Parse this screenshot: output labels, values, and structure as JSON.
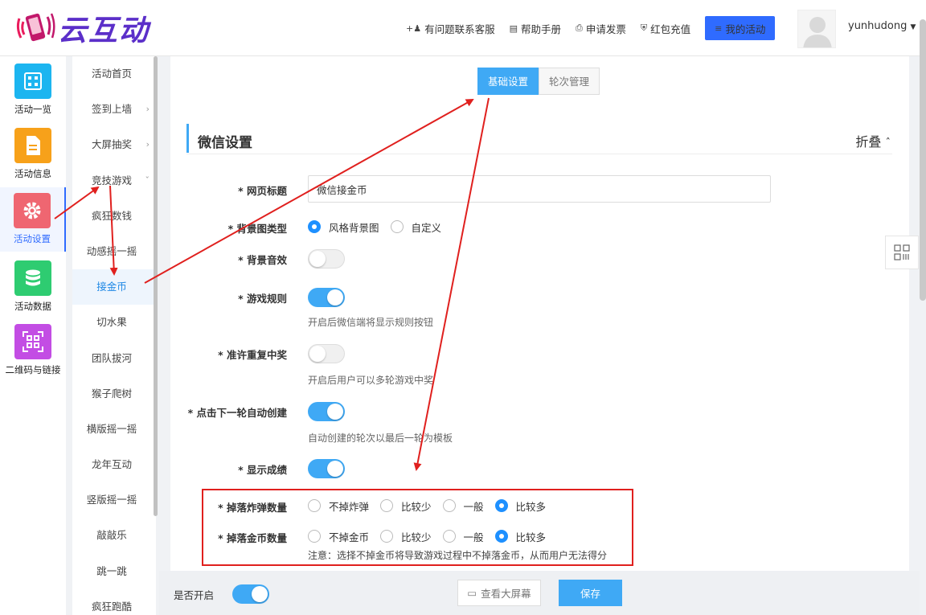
{
  "brand": {
    "name": "云互动"
  },
  "topnav": {
    "contact": "有问题联系客服",
    "help": "帮助手册",
    "invoice": "申请发票",
    "recharge": "红包充值",
    "my_activity": "我的活动"
  },
  "user": {
    "name": "yunhudong"
  },
  "iconbar": [
    {
      "label": "活动一览",
      "color": "#1cb5f0",
      "icon": "grid-icon"
    },
    {
      "label": "活动信息",
      "color": "#f7a11a",
      "icon": "document-icon"
    },
    {
      "label": "活动设置",
      "color": "#ef6671",
      "icon": "gear-icon",
      "active": true
    },
    {
      "label": "活动数据",
      "color": "#2ecc71",
      "icon": "database-icon"
    },
    {
      "label": "二维码与链接",
      "color": "#c34de4",
      "icon": "qrcode-icon"
    }
  ],
  "submenu": [
    {
      "label": "活动首页"
    },
    {
      "label": "签到上墙",
      "arrow": "›"
    },
    {
      "label": "大屏抽奖",
      "arrow": "›"
    },
    {
      "label": "竞技游戏",
      "arrow": "ˇ"
    },
    {
      "label": "疯狂数钱"
    },
    {
      "label": "动感摇一摇"
    },
    {
      "label": "接金币",
      "active": true
    },
    {
      "label": "切水果"
    },
    {
      "label": "团队拔河"
    },
    {
      "label": "猴子爬树"
    },
    {
      "label": "横版摇一摇"
    },
    {
      "label": "龙年互动"
    },
    {
      "label": "竖版摇一摇"
    },
    {
      "label": "敲敲乐"
    },
    {
      "label": "跳一跳"
    },
    {
      "label": "疯狂跑酷"
    }
  ],
  "tabs": {
    "basic": "基础设置",
    "rounds": "轮次管理"
  },
  "section": {
    "title": "微信设置",
    "fold": "折叠"
  },
  "form": {
    "page_title_label": "* 网页标题",
    "page_title_value": "微信接金币",
    "bg_type_label": "* 背景图类型",
    "bg_type_options": [
      "风格背景图",
      "自定义"
    ],
    "bg_music_label": "* 背景音效",
    "rules_label": "* 游戏规则",
    "rules_hint": "开启后微信端将显示规则按钮",
    "repeat_label": "* 准许重复中奖",
    "repeat_hint": "开启后用户可以多轮游戏中奖",
    "autocreate_label": "* 点击下一轮自动创建",
    "autocreate_hint": "自动创建的轮次以最后一轮为模板",
    "showscore_label": "* 显示成绩",
    "bombs_label": "* 掉落炸弹数量",
    "bombs_options": [
      "不掉炸弹",
      "比较少",
      "一般",
      "比较多"
    ],
    "coins_label": "* 掉落金币数量",
    "coins_options": [
      "不掉金币",
      "比较少",
      "一般",
      "比较多"
    ],
    "coins_hint": "注意：选择不掉金币将导致游戏过程中不掉落金币，从而用户无法得分"
  },
  "bottombar": {
    "enable_label": "是否开启",
    "view_screen": "查看大屏幕",
    "save": "保存"
  },
  "colors": {
    "accent": "#3fa9f5",
    "brand": "#5b2fc9",
    "primary_btn": "#2f6bff",
    "annotation": "#e0201e"
  }
}
